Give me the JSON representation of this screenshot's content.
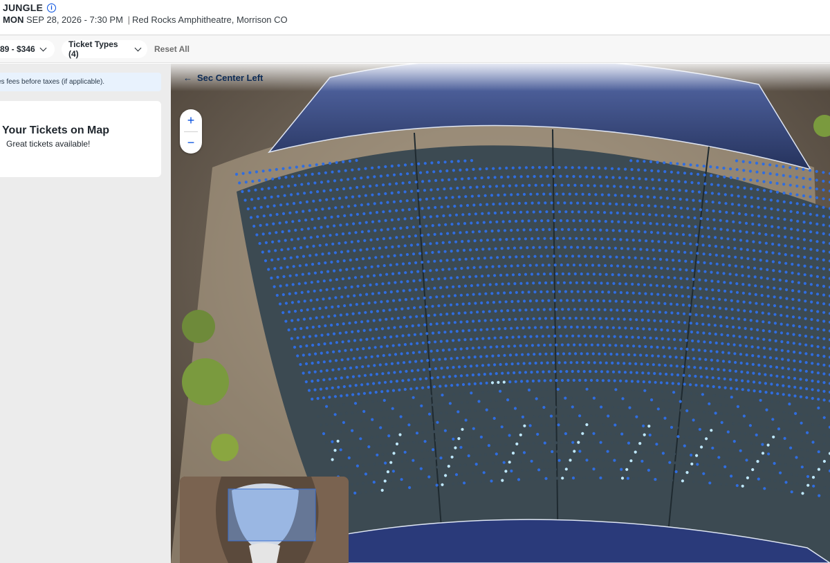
{
  "event": {
    "title": "JUNGLE",
    "info_icon": "i",
    "day": "MON",
    "datetime": "SEP 28, 2026 - 7:30 PM",
    "separator": "|",
    "venue": "Red Rocks Amphitheatre, Morrison CO"
  },
  "filters": {
    "price_range": "89 - $346",
    "ticket_types": "Ticket Types (4)",
    "reset": "Reset All"
  },
  "sidebar": {
    "fee_note": "es fees before taxes (if applicable).",
    "pick_title": "k Your Tickets on Map",
    "pick_subtitle": "Great tickets available!"
  },
  "map": {
    "back_arrow": "←",
    "section_label": "Sec Center Left",
    "zoom_in": "+",
    "zoom_out": "−"
  },
  "colors": {
    "accent": "#024ddf",
    "available_seat": "#2f6de0",
    "selected_seat": "#bfe9ff",
    "seat_unavailable": "#3a4a55"
  }
}
